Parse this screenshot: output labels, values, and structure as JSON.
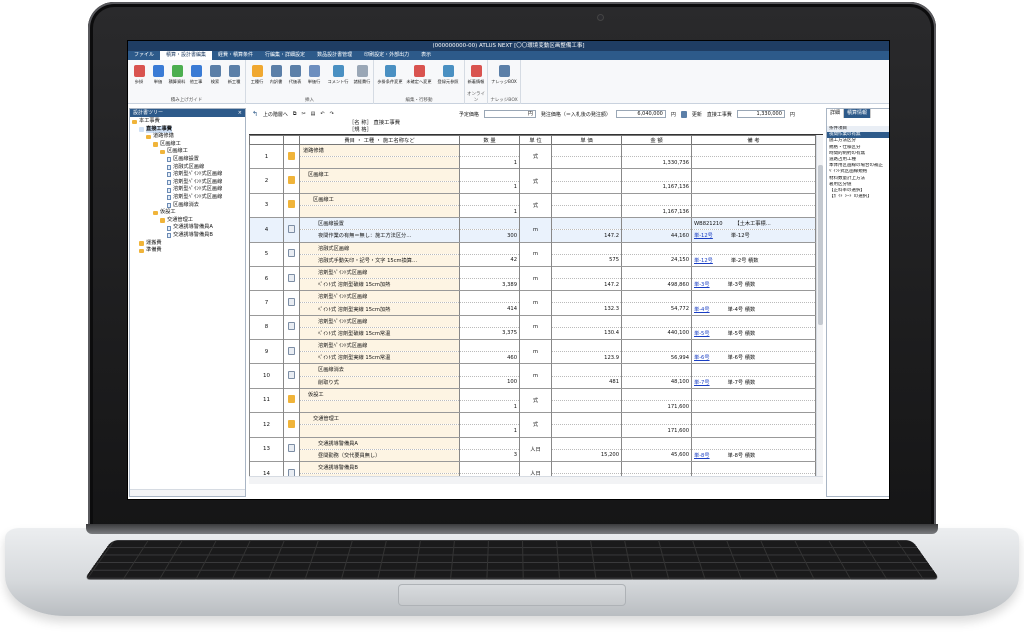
{
  "window": {
    "title": "(000000000-00) ATLUS NEXT [〇〇環境変動区画整備工事]"
  },
  "menu": [
    "ファイル",
    "積算・設計書編集",
    "経費・積算条件",
    "行編集・詳細設定",
    "数品設計書管理",
    "印刷設定・外部出力",
    "表示"
  ],
  "ribbon": {
    "groups": [
      {
        "label": "積み上げガイド",
        "buttons": [
          "歩掛",
          "単価",
          "積算資料",
          "他工事",
          "検索",
          "新工種"
        ]
      },
      {
        "label": "挿入",
        "buttons": [
          "工種行",
          "内訳書",
          "代価表",
          "単価行",
          "コメント行",
          "諸経費行"
        ]
      },
      {
        "label": "編集・行移動",
        "buttons": [
          "歩掛条件変更",
          "未確定へ変更",
          "登録元参照"
        ]
      },
      {
        "label": "オンライン",
        "buttons": [
          "新着情報"
        ]
      },
      {
        "label": "ナレッジBOX",
        "buttons": [
          "ナレッジBOX"
        ]
      }
    ]
  },
  "tree": {
    "title": "設計書ツリー",
    "close": "×",
    "nodes": [
      {
        "label": "本工事費",
        "level": 0,
        "type": "folder"
      },
      {
        "label": "直接工事費",
        "level": 1,
        "type": "folder",
        "selected": true
      },
      {
        "label": "道路修繕",
        "level": 2,
        "type": "folder"
      },
      {
        "label": "区画線工",
        "level": 3,
        "type": "folder"
      },
      {
        "label": "区画線工",
        "level": 4,
        "type": "folder"
      },
      {
        "label": "区画線設置",
        "level": 5,
        "type": "doc"
      },
      {
        "label": "溶融式区画線",
        "level": 5,
        "type": "doc"
      },
      {
        "label": "溶剤型ﾍﾟｲﾝﾄ式区画線",
        "level": 5,
        "type": "doc"
      },
      {
        "label": "溶剤型ﾍﾟｲﾝﾄ式区画線",
        "level": 5,
        "type": "doc"
      },
      {
        "label": "溶剤型ﾍﾟｲﾝﾄ式区画線",
        "level": 5,
        "type": "doc"
      },
      {
        "label": "溶剤型ﾍﾟｲﾝﾄ式区画線",
        "level": 5,
        "type": "doc"
      },
      {
        "label": "区画線消去",
        "level": 5,
        "type": "doc"
      },
      {
        "label": "仮設工",
        "level": 3,
        "type": "folder"
      },
      {
        "label": "交通管理工",
        "level": 4,
        "type": "folder"
      },
      {
        "label": "交通誘導警備員A",
        "level": 5,
        "type": "doc"
      },
      {
        "label": "交通誘導警備員B",
        "level": 5,
        "type": "doc"
      },
      {
        "label": "運搬費",
        "level": 1,
        "type": "folder"
      },
      {
        "label": "準備費",
        "level": 1,
        "type": "folder"
      }
    ]
  },
  "main": {
    "toolbar": {
      "up_label": "上の階層へ",
      "planned_label": "予定価格",
      "planned_unit": "円",
      "order_label": "発注価格（＝入札後の発注額）",
      "order_value": "6,040,000",
      "order_unit": "円",
      "update_label": "更新",
      "direct_label": "直接工事費",
      "direct_value": "1,330,000",
      "direct_unit": "円"
    },
    "name_line1": "［名 称］ 直接工事費",
    "name_line2": "［規 格］",
    "headers": [
      "費目 ・ 工種 ・ 施工名称など",
      "数 量",
      "単 位",
      "単 価",
      "金 額",
      "備 考"
    ],
    "rows": [
      {
        "no": "1",
        "icon": "folder",
        "indent": 0,
        "name1": "道路修繕",
        "name2": "",
        "qty": "1",
        "unit": "式",
        "price": "",
        "amount": "1,330,736",
        "link": "",
        "note1": "",
        "note2": ""
      },
      {
        "no": "2",
        "icon": "folder",
        "indent": 1,
        "name1": "区画線工",
        "name2": "",
        "qty": "1",
        "unit": "式",
        "price": "",
        "amount": "1,167,136",
        "link": "",
        "note1": "",
        "note2": ""
      },
      {
        "no": "3",
        "icon": "folder",
        "indent": 2,
        "name1": "区画線工",
        "name2": "",
        "qty": "1",
        "unit": "式",
        "price": "",
        "amount": "1,167,136",
        "link": "",
        "note1": "",
        "note2": ""
      },
      {
        "no": "4",
        "icon": "doc",
        "indent": 3,
        "name1": "区画線設置",
        "name2": "夜間作業の有無＝無し：施工方法区分…",
        "qty": "300",
        "unit": "m",
        "price": "147.2",
        "amount": "44,160",
        "link": "単-12号",
        "note0": "WB821210",
        "note1": "【土木工事標…",
        "note2": "単-12号"
      },
      {
        "no": "5",
        "icon": "doc",
        "indent": 3,
        "name1": "溶融式区画線",
        "name2": "溶融式手動矢印・記号・文字 15cm換算…",
        "qty": "42",
        "unit": "m",
        "price": "575",
        "amount": "24,150",
        "link": "単-12号",
        "note1": "",
        "note2": "単-2号 積数"
      },
      {
        "no": "6",
        "icon": "doc",
        "indent": 3,
        "name1": "溶剤型ﾍﾟｲﾝﾄ式区画線",
        "name2": "ﾍﾟｲﾝﾄ式 溶剤型破線 15cm加熱",
        "qty": "3,389",
        "unit": "m",
        "price": "147.2",
        "amount": "498,860",
        "link": "単-3号",
        "note1": "",
        "note2": "単-3号 積数"
      },
      {
        "no": "7",
        "icon": "doc",
        "indent": 3,
        "name1": "溶剤型ﾍﾟｲﾝﾄ式区画線",
        "name2": "ﾍﾟｲﾝﾄ式 溶剤型実線 15cm加熱",
        "qty": "414",
        "unit": "m",
        "price": "132.3",
        "amount": "54,772",
        "link": "単-4号",
        "note1": "",
        "note2": "単-4号 積数"
      },
      {
        "no": "8",
        "icon": "doc",
        "indent": 3,
        "name1": "溶剤型ﾍﾟｲﾝﾄ式区画線",
        "name2": "ﾍﾟｲﾝﾄ式 溶剤型破線 15cm常温",
        "qty": "3,375",
        "unit": "m",
        "price": "130.4",
        "amount": "440,100",
        "link": "単-5号",
        "note1": "",
        "note2": "単-5号 積数"
      },
      {
        "no": "9",
        "icon": "doc",
        "indent": 3,
        "name1": "溶剤型ﾍﾟｲﾝﾄ式区画線",
        "name2": "ﾍﾟｲﾝﾄ式 溶剤型実線 15cm常温",
        "qty": "460",
        "unit": "m",
        "price": "123.9",
        "amount": "56,994",
        "link": "単-6号",
        "note1": "",
        "note2": "単-6号 積数"
      },
      {
        "no": "10",
        "icon": "doc",
        "indent": 3,
        "name1": "区画線消去",
        "name2": "削取り式",
        "qty": "100",
        "unit": "m",
        "price": "481",
        "amount": "48,100",
        "link": "単-7号",
        "note1": "",
        "note2": "単-7号 積数"
      },
      {
        "no": "11",
        "icon": "folder",
        "indent": 1,
        "name1": "仮設工",
        "name2": "",
        "qty": "1",
        "unit": "式",
        "price": "",
        "amount": "171,600",
        "link": "",
        "note1": "",
        "note2": ""
      },
      {
        "no": "12",
        "icon": "folder",
        "indent": 2,
        "name1": "交通管理工",
        "name2": "",
        "qty": "1",
        "unit": "式",
        "price": "",
        "amount": "171,600",
        "link": "",
        "note1": "",
        "note2": ""
      },
      {
        "no": "13",
        "icon": "doc",
        "indent": 3,
        "name1": "交通誘導警備員A",
        "name2": "昼間勤務（交代要員無し）",
        "qty": "3",
        "unit": "人日",
        "price": "15,200",
        "amount": "45,600",
        "link": "単-8号",
        "note1": "",
        "note2": "単-8号 積数"
      },
      {
        "no": "14",
        "icon": "doc",
        "indent": 3,
        "name1": "交通誘導警備員B",
        "name2": "",
        "qty": "",
        "unit": "人日",
        "price": "",
        "amount": "",
        "link": "",
        "note1": "",
        "note2": ""
      }
    ]
  },
  "rpanel": {
    "tabs": [
      "詳細",
      "積算情報"
    ],
    "items": [
      "条件項目",
      "夜間作業の有無",
      "施工方法区分",
      "規格・仕様区分",
      "時間的制約の有無",
      "道路占用工種",
      "本体用区画線の場合の補正",
      "ﾍﾟｲﾝﾄ式区画線規格",
      "材料数量計上方法",
      "著用区分値",
      "【正料率の選択】",
      "【ｶﾞｲﾄﾞｼｰﾄﾞの選択】"
    ]
  },
  "colors": {
    "accent": "#2d5a8a",
    "title": "#1f3d63",
    "folder": "#f0b43a",
    "link": "#1a3fc4"
  }
}
